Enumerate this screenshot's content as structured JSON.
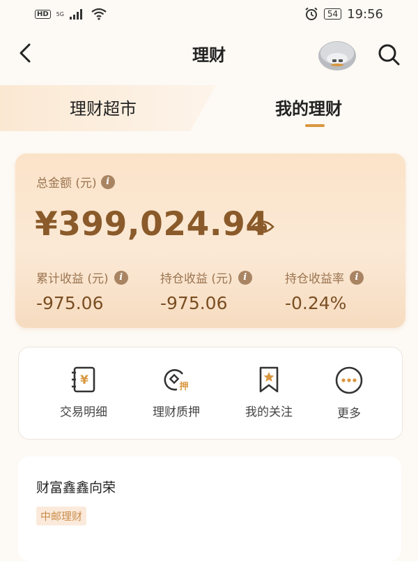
{
  "status_bar": {
    "hd": "HD",
    "signal": "5G",
    "battery": "54",
    "time": "19:56"
  },
  "nav": {
    "title": "理财"
  },
  "tabs": [
    {
      "label": "理财超市",
      "active": false
    },
    {
      "label": "我的理财",
      "active": true
    }
  ],
  "summary": {
    "total_label": "总金额 (元)",
    "total_value": "¥399,024.94",
    "metrics": [
      {
        "label": "累计收益 (元)",
        "value": "-975.06"
      },
      {
        "label": "持仓收益 (元)",
        "value": "-975.06"
      },
      {
        "label": "持仓收益率",
        "value": "-0.24%"
      }
    ]
  },
  "actions": [
    {
      "label": "交易明细",
      "icon": "transaction-detail-icon"
    },
    {
      "label": "理财质押",
      "icon": "pledge-icon",
      "icon_text": "押"
    },
    {
      "label": "我的关注",
      "icon": "bookmark-icon"
    },
    {
      "label": "更多",
      "icon": "more-icon"
    }
  ],
  "product": {
    "name": "财富鑫鑫向荣",
    "tag": "中邮理财"
  },
  "colors": {
    "accent": "#d9963f",
    "gold_text": "#8a5a2a",
    "card_bg": "#fbe3c8"
  }
}
